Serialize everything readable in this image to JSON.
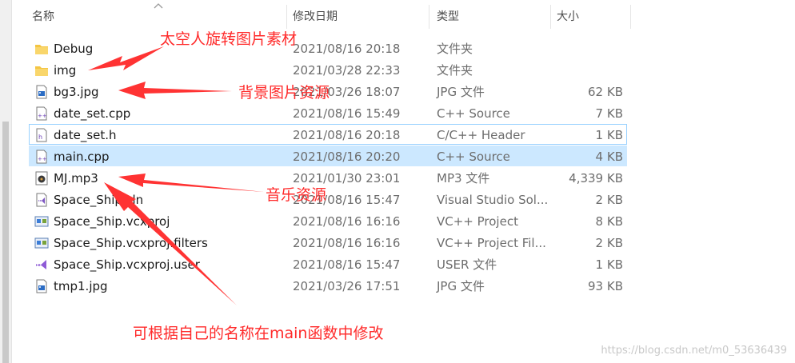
{
  "columns": {
    "name": "名称",
    "date": "修改日期",
    "type": "类型",
    "size": "大小"
  },
  "files": [
    {
      "name": "Debug",
      "date": "2021/08/16 20:18",
      "type": "文件夹",
      "size": "",
      "icon": "folder-icon"
    },
    {
      "name": "img",
      "date": "2021/03/28 22:33",
      "type": "文件夹",
      "size": "",
      "icon": "folder-icon"
    },
    {
      "name": "bg3.jpg",
      "date": "2021/03/26 18:07",
      "type": "JPG 文件",
      "size": "62 KB",
      "icon": "image-file-icon"
    },
    {
      "name": "date_set.cpp",
      "date": "2021/08/16 15:49",
      "type": "C++ Source",
      "size": "7 KB",
      "icon": "cpp-file-icon"
    },
    {
      "name": "date_set.h",
      "date": "2021/08/16 20:18",
      "type": "C/C++ Header",
      "size": "1 KB",
      "icon": "header-file-icon"
    },
    {
      "name": "main.cpp",
      "date": "2021/08/16 20:20",
      "type": "C++ Source",
      "size": "4 KB",
      "icon": "cpp-file-icon"
    },
    {
      "name": "MJ.mp3",
      "date": "2021/01/30 23:01",
      "type": "MP3 文件",
      "size": "4,339 KB",
      "icon": "audio-file-icon"
    },
    {
      "name": "Space_Ship.sln",
      "date": "2021/08/16 15:47",
      "type": "Visual Studio Sol...",
      "size": "2 KB",
      "icon": "visual-studio-solution-icon"
    },
    {
      "name": "Space_Ship.vcxproj",
      "date": "2021/08/16 16:16",
      "type": "VC++ Project",
      "size": "8 KB",
      "icon": "vcxproj-file-icon"
    },
    {
      "name": "Space_Ship.vcxproj.filters",
      "date": "2021/08/16 16:16",
      "type": "VC++ Project Fil...",
      "size": "2 KB",
      "icon": "vcxproj-file-icon"
    },
    {
      "name": "Space_Ship.vcxproj.user",
      "date": "2021/08/16 15:47",
      "type": "USER 文件",
      "size": "1 KB",
      "icon": "visual-studio-user-icon"
    },
    {
      "name": "tmp1.jpg",
      "date": "2021/03/26 17:51",
      "type": "JPG 文件",
      "size": "93 KB",
      "icon": "image-file-icon"
    }
  ],
  "annotations": {
    "img_note": "太空人旋转图片素材",
    "bg_note": "背景图片资源",
    "music_note": "音乐资源",
    "main_note": "可根据自己的名称在main函数中修改"
  },
  "watermark": "https://blog.csdn.net/m0_53636439",
  "colors": {
    "annotation": "#ff2a2a",
    "selection": "#cce8ff",
    "folder": "#f4c542"
  }
}
